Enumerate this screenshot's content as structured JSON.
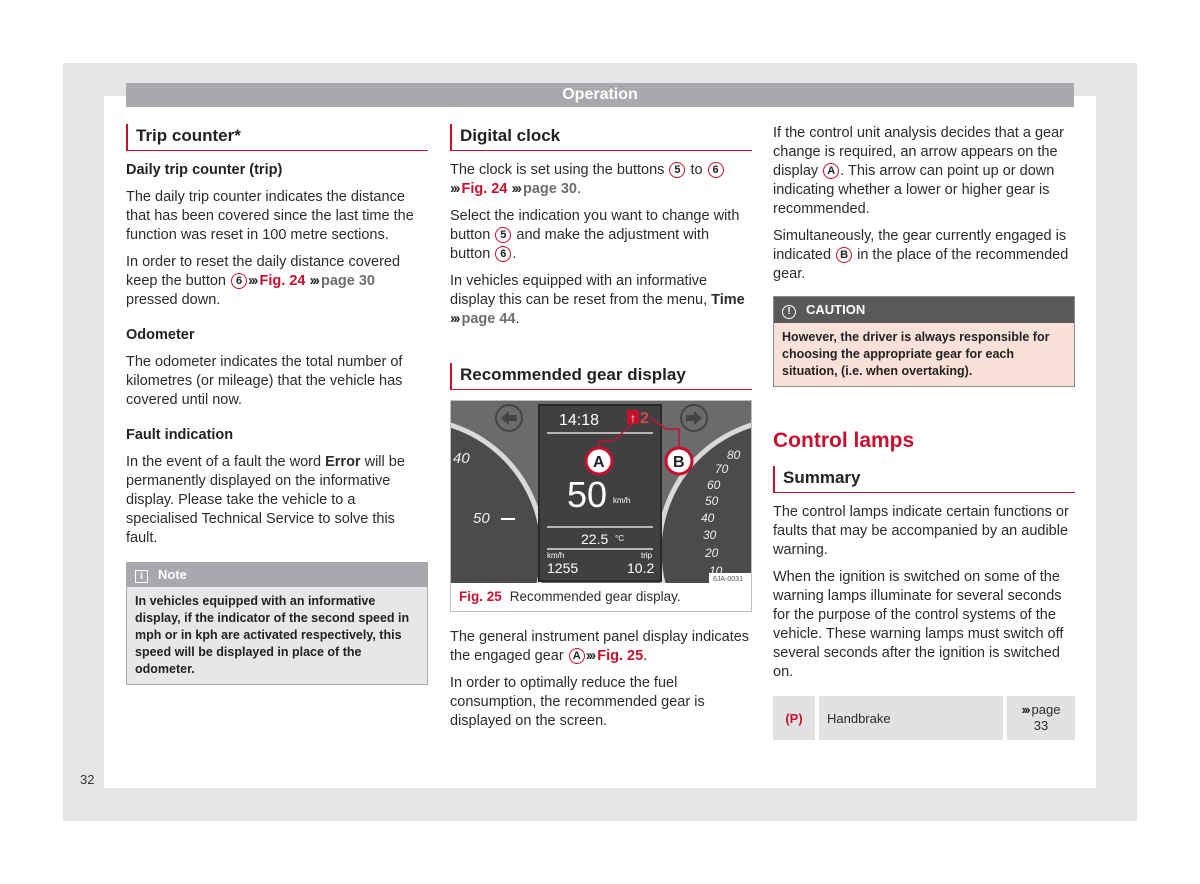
{
  "header": {
    "title": "Operation"
  },
  "page_number": "32",
  "col1": {
    "title": "Trip counter*",
    "daily_heading": "Daily trip counter (trip)",
    "daily_p1": "The daily trip counter indicates the distance that has been covered since the last time the function was reset in 100 metre sections.",
    "daily_p2_a": "In order to reset the daily distance covered keep the button",
    "daily_p2_btn": "6",
    "daily_p2_fig": "Fig. 24",
    "daily_p2_page": "page 30",
    "daily_p2_b": "pressed down.",
    "odometer_heading": "Odometer",
    "odometer_p": "The odometer indicates the total number of kilometres (or mileage) that the vehicle has covered until now.",
    "fault_heading": "Fault indication",
    "fault_p_a": "In the event of a fault the word",
    "fault_p_bold": "Error",
    "fault_p_b": "will be permanently displayed on the informative display. Please take the vehicle to a specialised Technical Service to solve this fault.",
    "note": {
      "icon": "info-icon",
      "title": "Note",
      "body": "In vehicles equipped with an informative display, if the indicator of the second speed in mph or in kph are activated respectively, this speed will be displayed in place of the odometer."
    }
  },
  "col2": {
    "title": "Digital clock",
    "p1_a": "The clock is set using the buttons",
    "p1_btn1": "5",
    "p1_to": "to",
    "p1_btn2": "6",
    "p1_fig": "Fig. 24",
    "p1_page": "page 30",
    "p2_a": "Select the indication you want to change with button",
    "p2_btn1": "5",
    "p2_b": "and make the adjustment with button",
    "p2_btn2": "6",
    "p3_a": "In vehicles equipped with an informative display this can be reset from the menu,",
    "p3_bold": "Time",
    "p3_page": "page 44",
    "gear_title": "Recommended gear display",
    "figure": {
      "time": "14:18",
      "gear": "2",
      "speed": "50",
      "speed_unit": "km/h",
      "temp": "22.5",
      "temp_unit": "°C",
      "left_label": "km/h",
      "left_value": "1255",
      "right_label": "trip",
      "right_value": "10.2",
      "callout_a": "A",
      "callout_b": "B",
      "code": "6JA-0031",
      "gauge_left": [
        "40",
        "50"
      ],
      "gauge_right": [
        "80",
        "70",
        "60",
        "50",
        "40",
        "30",
        "20",
        "10"
      ],
      "caption_ref": "Fig. 25",
      "caption": "Recommended gear display."
    },
    "p4_a": "The general instrument panel display indicates the engaged gear",
    "p4_btn": "A",
    "p4_fig": "Fig. 25",
    "p5": "In order to optimally reduce the fuel consumption, the recommended gear is displayed on the screen."
  },
  "col3": {
    "p1_a": "If the control unit analysis decides that a gear change is required, an arrow appears on the display",
    "p1_btn": "A",
    "p1_b": ". This arrow can point up or down indicating whether a lower or higher gear is recommended.",
    "p2_a": "Simultaneously, the gear currently engaged is indicated",
    "p2_btn": "B",
    "p2_b": "in the place of the recommended gear.",
    "caution": {
      "icon": "exclamation-circle-icon",
      "title": "CAUTION",
      "body": "However, the driver is always responsible for choosing the appropriate gear for each situation, (i.e. when overtaking)."
    },
    "section_title": "Control lamps",
    "summary_title": "Summary",
    "p3": "The control lamps indicate certain functions or faults that may be accompanied by an audible warning.",
    "p4": "When the ignition is switched on some of the warning lamps illuminate for several seconds for the purpose of the control systems of the vehicle. These warning lamps must switch off several seconds after the ignition is switched on.",
    "lamp_table": [
      {
        "icon": "handbrake-icon",
        "symbol": "(P)",
        "label": "Handbrake",
        "ref": "page",
        "page": "33"
      }
    ]
  },
  "colors": {
    "accent": "#c8102e",
    "header_grey": "#a7a9ac",
    "caution_bg": "#f9e1da"
  }
}
